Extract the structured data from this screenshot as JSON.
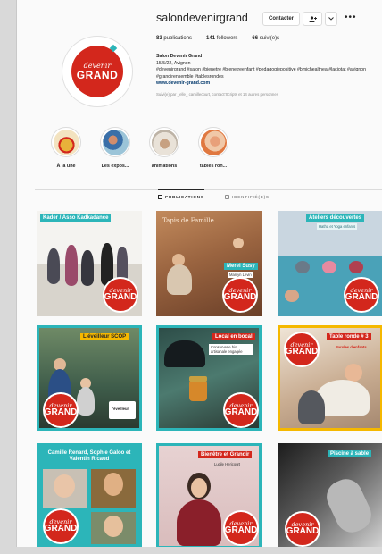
{
  "profile": {
    "username": "salondevenirgrand",
    "contact_label": "Contacter",
    "follow_icon": "add-person-icon",
    "dropdown_icon": "chevron-down-icon",
    "more_icon": "more-icon",
    "more_text": "•••",
    "avatar_logo_top": "devenir",
    "avatar_logo_bottom": "GRAND",
    "stats": {
      "posts_count": "83",
      "posts_label": "publications",
      "followers_count": "141",
      "followers_label": "followers",
      "following_count": "66",
      "following_label": "suivi(e)s"
    },
    "bio": {
      "name": "Salon Devenir Grand",
      "dates": "15/5/22, Avignon",
      "hashtags": "#devenirgrand #salon #bienetre #bienetreenfant #pedagogiepositive #bmichealthea #laciotat #avignon #grandirensemble #tablesrondes",
      "link": "www.devenir-grand.com",
      "followed_by": "Suivi(e) par _elle_ camillecourt, contact'Scripts et 14 autres personnes"
    }
  },
  "highlights": [
    {
      "label": "À la une"
    },
    {
      "label": "Les expos..."
    },
    {
      "label": "animations"
    },
    {
      "label": "tables ron..."
    }
  ],
  "tabs": {
    "publications": "PUBLICATIONS",
    "tagged": "IDENTIFIÉ(E)S"
  },
  "posts": [
    {
      "title": "Kader / Asso Kadkadance"
    },
    {
      "title": "Tapis de Famille",
      "caption": "Merel Susy",
      "sub": "Marilyn Levin"
    },
    {
      "title": "Ateliers découvertes",
      "sub": "Hatha et Yoga enfants"
    },
    {
      "title": "L'éveilleur SCOP",
      "sub": "l'éveilleur"
    },
    {
      "title": "Local en bocal",
      "sub": "Conserverie bio artisanale engagée"
    },
    {
      "title": "Table ronde # 3",
      "sub": "Paroles d'enfants"
    },
    {
      "title": "Camille Renard, Sophie Galoo et Valentin Ricaud"
    },
    {
      "title": "Bienêtre et Grandir",
      "sub": "Lucile Hericourt"
    },
    {
      "title": "Piscine à sable"
    }
  ],
  "badge": {
    "top": "devenir",
    "bottom": "GRAND"
  },
  "colors": {
    "brand_red": "#d3271c",
    "teal": "#2cb5b9",
    "yellow": "#f5b800"
  }
}
